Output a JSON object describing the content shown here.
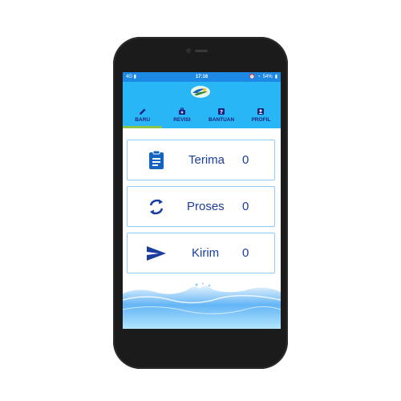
{
  "status_bar": {
    "network": "4G",
    "time": "17:16",
    "battery": "54%"
  },
  "tabs": [
    {
      "label": "BARU",
      "icon": "pencil-icon",
      "active": true
    },
    {
      "label": "REVISI",
      "icon": "briefcase-plus-icon",
      "active": false
    },
    {
      "label": "BANTUAN",
      "icon": "help-icon",
      "active": false
    },
    {
      "label": "PROFIL",
      "icon": "profile-icon",
      "active": false
    }
  ],
  "cards": [
    {
      "label": "Terima",
      "count": "0",
      "icon": "clipboard-icon"
    },
    {
      "label": "Proses",
      "count": "0",
      "icon": "sync-icon"
    },
    {
      "label": "Kirim",
      "count": "0",
      "icon": "send-icon"
    }
  ],
  "colors": {
    "status_bar": "#1e88e5",
    "app_bar": "#29b6f6",
    "tab_indicator": "#8bc34a",
    "card_text": "#1a3d9e",
    "card_border": "#90caf9",
    "icon_blue": "#1565c0"
  }
}
